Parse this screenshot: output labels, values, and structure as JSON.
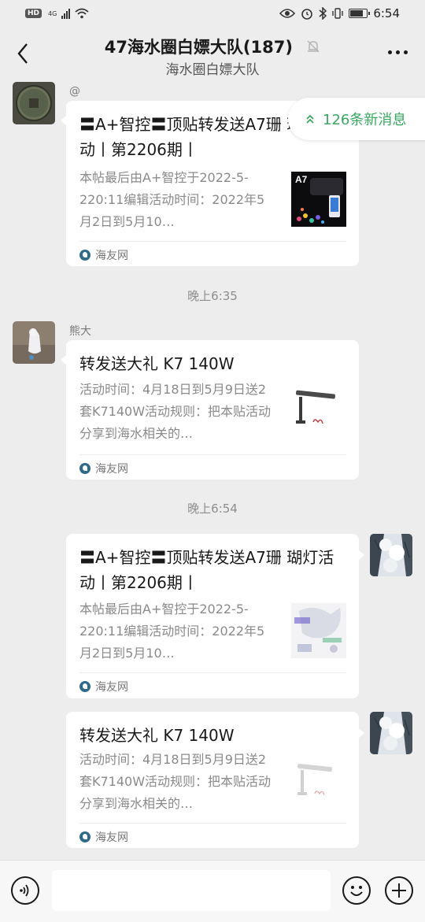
{
  "status_bar": {
    "badge": "HD",
    "network": "4G",
    "time": "6:54",
    "battery_level": 0.85
  },
  "header": {
    "title": "47海水圈白嫖大队(187)",
    "subtitle": "海水圈白嫖大队",
    "back_icon": "chevron-left-icon",
    "mute_icon": "bell-off-icon",
    "more_icon": "more-dots-icon"
  },
  "new_messages": {
    "label": "126条新消息",
    "icon": "double-chevron-up-icon"
  },
  "messages": [
    {
      "sender": "@",
      "side": "left",
      "title": "〓A+智控〓顶贴转发送A7珊 瑚灯活动丨第2206期丨",
      "desc": "本帖最后由A+智控于2022-5-220:11编辑活动时间：2022年5月2日到5月10…",
      "thumb_label": "A7",
      "source": "海友网"
    },
    {
      "timestamp": "晚上6:35"
    },
    {
      "sender": "熊大",
      "side": "left",
      "title": "转发送大礼 K7 140W",
      "desc": "活动时间：4月18日到5月9日送2套K7140W活动规则：把本贴活动分享到海水相关的…",
      "thumb_label": "",
      "source": "海友网"
    },
    {
      "timestamp": "晚上6:54"
    },
    {
      "side": "right",
      "title": "〓A+智控〓顶贴转发送A7珊 瑚灯活动丨第2206期丨",
      "desc": "本帖最后由A+智控于2022-5-220:11编辑活动时间：2022年5月2日到5月10…",
      "thumb_label": "",
      "source": "海友网"
    },
    {
      "side": "right",
      "title": "转发送大礼 K7 140W",
      "desc": "活动时间：4月18日到5月9日送2套K7140W活动规则：把本贴活动分享到海水相关的…",
      "thumb_label": "",
      "source": "海友网"
    }
  ],
  "input_bar": {
    "voice_icon": "voice-icon",
    "emoji_icon": "emoji-icon",
    "plus_icon": "plus-icon",
    "placeholder": ""
  },
  "colors": {
    "background": "#ededed",
    "accent_green": "#3aa760",
    "card": "#ffffff"
  }
}
